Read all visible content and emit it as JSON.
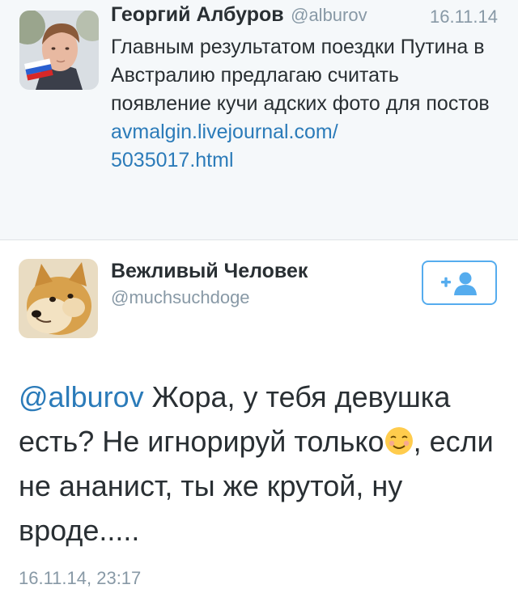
{
  "parent_tweet": {
    "author_name": "Георгий Албуров",
    "author_handle": "@alburov",
    "date": "16.11.14",
    "text": "Главным результатом поездки Путина в Австралию предлагаю считать появление кучи адских фото для постов",
    "link_line1": "avmalgin.livejournal.com/",
    "link_line2": "5035017.html"
  },
  "reply_tweet": {
    "author_name": "Вежливый Человек",
    "author_handle": "@muchsuchdoge",
    "follow_icon": "add-user-icon",
    "mention": "@alburov",
    "text_part1": " Жора, у тебя девушка есть? Не игнорируй только",
    "emoji": "relaxed-smile-emoji",
    "text_part2": ", если не ананист, ты же крутой, ну вроде.....",
    "timestamp": "16.11.14, 23:17"
  },
  "colors": {
    "link": "#2b7bb9",
    "muted": "#8899a6",
    "text": "#292f33",
    "follow_border": "#55acee",
    "parent_bg": "#f5f8fa"
  }
}
